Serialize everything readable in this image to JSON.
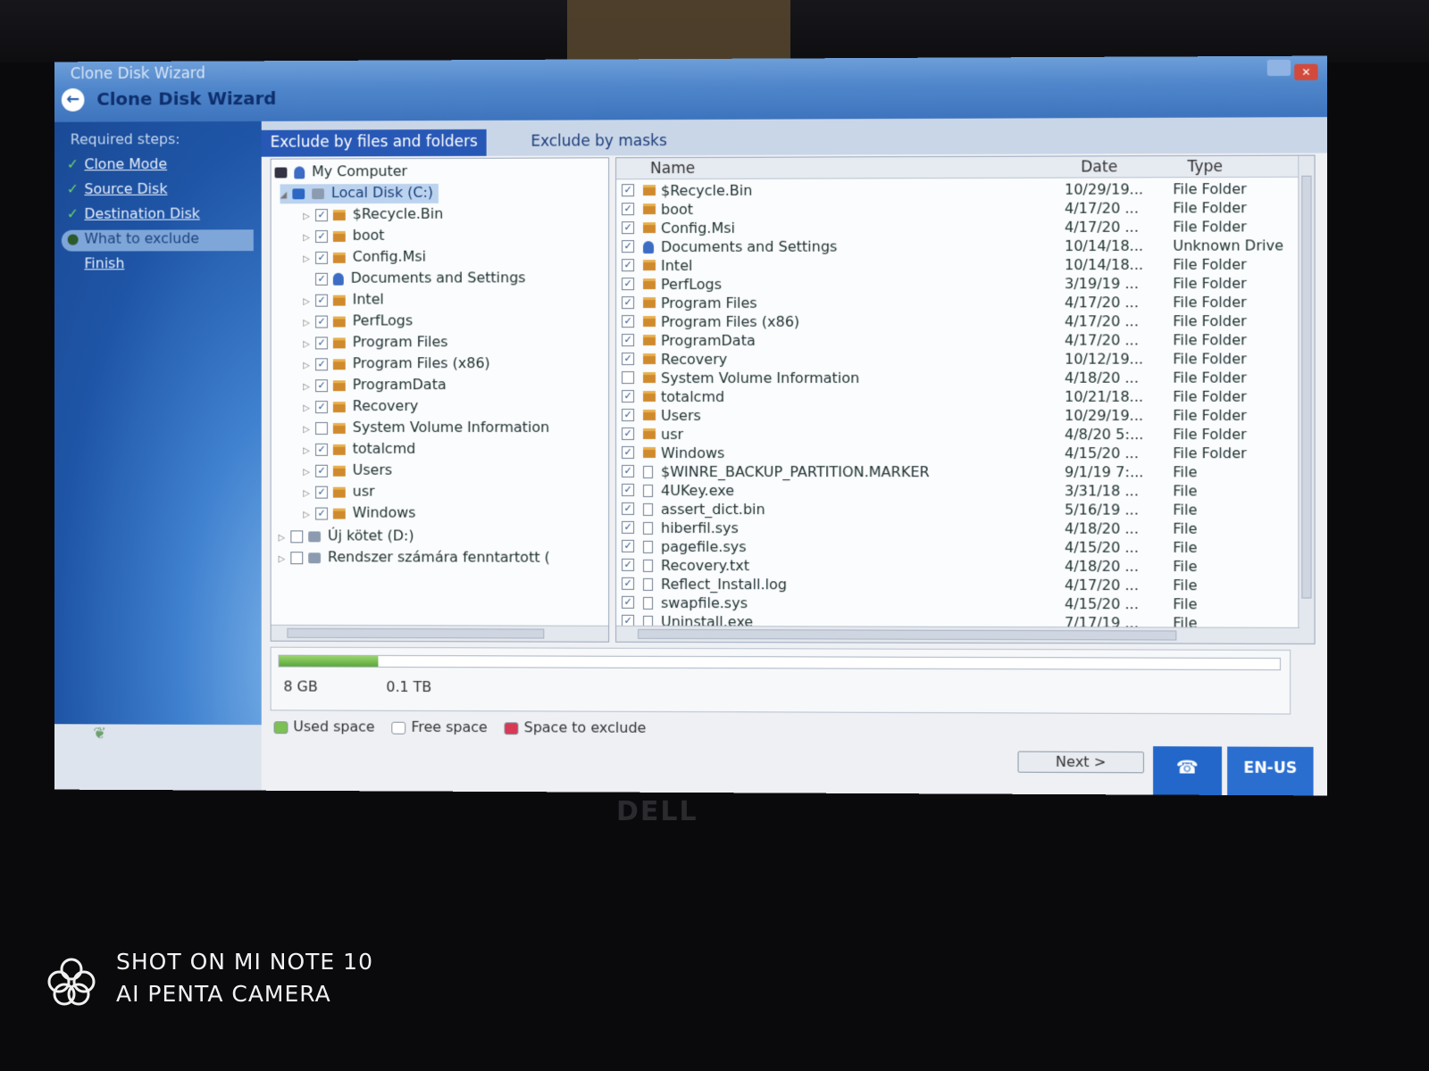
{
  "window": {
    "title": "Clone Disk Wizard",
    "wizard_title": "Clone Disk Wizard",
    "controls": [
      "",
      "✕"
    ]
  },
  "sidebar": {
    "heading": "Required steps:",
    "steps": [
      {
        "label": "Clone Mode",
        "done": true
      },
      {
        "label": "Source Disk",
        "done": true
      },
      {
        "label": "Destination Disk",
        "done": true
      },
      {
        "label": "What to exclude",
        "active": true
      },
      {
        "label": "Finish"
      }
    ]
  },
  "tabs": [
    {
      "label": "Exclude by files and folders",
      "active": true
    },
    {
      "label": "Exclude by masks"
    }
  ],
  "tree": {
    "root": "My Computer",
    "drive": "Local Disk (C:)",
    "items": [
      {
        "label": "$Recycle.Bin",
        "checked": true
      },
      {
        "label": "boot",
        "checked": true
      },
      {
        "label": "Config.Msi",
        "checked": true
      },
      {
        "label": "Documents and Settings",
        "checked": true
      },
      {
        "label": "Intel",
        "checked": true
      },
      {
        "label": "PerfLogs",
        "checked": true
      },
      {
        "label": "Program Files",
        "checked": true
      },
      {
        "label": "Program Files (x86)",
        "checked": true
      },
      {
        "label": "ProgramData",
        "checked": true
      },
      {
        "label": "Recovery",
        "checked": true
      },
      {
        "label": "System Volume Information",
        "checked": false
      },
      {
        "label": "totalcmd",
        "checked": true
      },
      {
        "label": "Users",
        "checked": true
      },
      {
        "label": "usr",
        "checked": true
      },
      {
        "label": "Windows",
        "checked": true
      }
    ],
    "other_drives": [
      "Új kötet (D:)",
      "Rendszer számára fenntartott ("
    ]
  },
  "list": {
    "columns": [
      "Name",
      "Date",
      "Type"
    ],
    "rows": [
      {
        "name": "$Recycle.Bin",
        "date": "10/29/19...",
        "type": "File Folder",
        "kind": "folder",
        "checked": true
      },
      {
        "name": "boot",
        "date": "4/17/20 ...",
        "type": "File Folder",
        "kind": "folder",
        "checked": true
      },
      {
        "name": "Config.Msi",
        "date": "4/17/20 ...",
        "type": "File Folder",
        "kind": "folder",
        "checked": true
      },
      {
        "name": "Documents and Settings",
        "date": "10/14/18...",
        "type": "Unknown Drive",
        "kind": "docs",
        "checked": true
      },
      {
        "name": "Intel",
        "date": "10/14/18...",
        "type": "File Folder",
        "kind": "folder",
        "checked": true
      },
      {
        "name": "PerfLogs",
        "date": "3/19/19 ...",
        "type": "File Folder",
        "kind": "folder",
        "checked": true
      },
      {
        "name": "Program Files",
        "date": "4/17/20 ...",
        "type": "File Folder",
        "kind": "folder",
        "checked": true
      },
      {
        "name": "Program Files (x86)",
        "date": "4/17/20 ...",
        "type": "File Folder",
        "kind": "folder",
        "checked": true
      },
      {
        "name": "ProgramData",
        "date": "4/17/20 ...",
        "type": "File Folder",
        "kind": "folder",
        "checked": true
      },
      {
        "name": "Recovery",
        "date": "10/12/19...",
        "type": "File Folder",
        "kind": "folder",
        "checked": true
      },
      {
        "name": "System Volume Information",
        "date": "4/18/20 ...",
        "type": "File Folder",
        "kind": "folder",
        "checked": false
      },
      {
        "name": "totalcmd",
        "date": "10/21/18...",
        "type": "File Folder",
        "kind": "folder",
        "checked": true
      },
      {
        "name": "Users",
        "date": "10/29/19...",
        "type": "File Folder",
        "kind": "folder",
        "checked": true
      },
      {
        "name": "usr",
        "date": "4/8/20 5:...",
        "type": "File Folder",
        "kind": "folder",
        "checked": true
      },
      {
        "name": "Windows",
        "date": "4/15/20 ...",
        "type": "File Folder",
        "kind": "folder",
        "checked": true
      },
      {
        "name": "$WINRE_BACKUP_PARTITION.MARKER",
        "date": "9/1/19 7:...",
        "type": "File",
        "kind": "file",
        "checked": true
      },
      {
        "name": "4UKey.exe",
        "date": "3/31/18 ...",
        "type": "File",
        "kind": "file",
        "checked": true
      },
      {
        "name": "assert_dict.bin",
        "date": "5/16/19 ...",
        "type": "File",
        "kind": "file",
        "checked": true
      },
      {
        "name": "hiberfil.sys",
        "date": "4/18/20 ...",
        "type": "File",
        "kind": "file",
        "checked": true
      },
      {
        "name": "pagefile.sys",
        "date": "4/15/20 ...",
        "type": "File",
        "kind": "file",
        "checked": true
      },
      {
        "name": "Recovery.txt",
        "date": "4/18/20 ...",
        "type": "File",
        "kind": "file",
        "checked": true
      },
      {
        "name": "Reflect_Install.log",
        "date": "4/17/20 ...",
        "type": "File",
        "kind": "file",
        "checked": true
      },
      {
        "name": "swapfile.sys",
        "date": "4/15/20 ...",
        "type": "File",
        "kind": "file",
        "checked": true
      },
      {
        "name": "Uninstall.exe",
        "date": "7/17/19 ...",
        "type": "File",
        "kind": "file",
        "checked": true
      }
    ]
  },
  "disk": {
    "used_label": "8 GB",
    "total_label": "0.1 TB",
    "used_fraction": 0.1
  },
  "legend": {
    "used": "Used space",
    "free": "Free space",
    "exclude": "Space to exclude",
    "colors": {
      "used": "#7cc152",
      "free": "#ffffff",
      "exclude": "#d63a55"
    }
  },
  "buttons": {
    "next": "Next >",
    "lang": "EN-US"
  },
  "photo": {
    "brand": "DELL",
    "watermark_line1": "SHOT ON MI NOTE 10",
    "watermark_line2": "AI PENTA CAMERA"
  }
}
